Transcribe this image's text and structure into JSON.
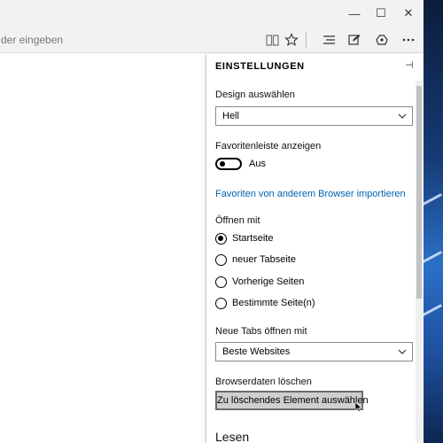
{
  "address_bar": {
    "placeholder_fragment": "der eingeben"
  },
  "window_controls": {
    "minimize": "—",
    "maximize": "☐",
    "close": "✕"
  },
  "toolbar_icons": [
    "reading-view-icon",
    "favorite-star-icon",
    "hub-icon",
    "web-note-icon",
    "share-icon",
    "more-icon"
  ],
  "settings": {
    "title": "EINSTELLUNGEN",
    "design": {
      "label": "Design auswählen",
      "value": "Hell"
    },
    "favorites_bar": {
      "label": "Favoritenleiste anzeigen",
      "state": "Aus"
    },
    "import_link": "Favoriten von anderem Browser importieren",
    "open_with": {
      "label": "Öffnen mit",
      "options": [
        "Startseite",
        "neuer Tabseite",
        "Vorherige Seiten",
        "Bestimmte Seite(n)"
      ],
      "selected": "Startseite"
    },
    "new_tabs": {
      "label": "Neue Tabs öffnen mit",
      "value": "Beste Websites"
    },
    "clear_data": {
      "label": "Browserdaten löschen",
      "button": "Zu löschendes Element auswählen"
    },
    "reading": {
      "label": "Lesen"
    }
  },
  "colors": {
    "link": "#0063b1",
    "chrome": "#f2f2f2",
    "button": "#cfcfcf"
  }
}
